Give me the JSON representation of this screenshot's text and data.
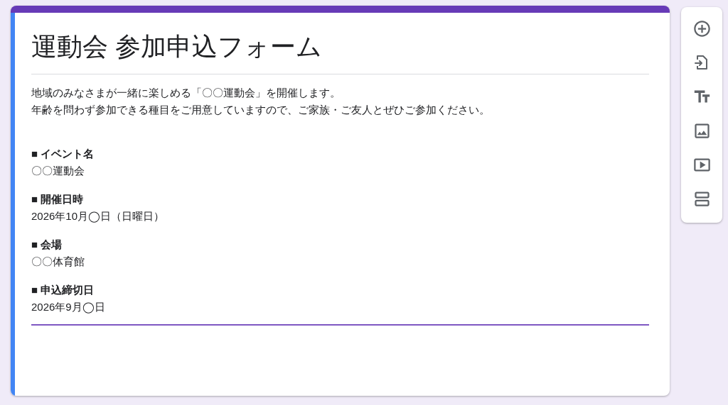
{
  "form": {
    "title": "運動会 参加申込フォーム",
    "description": [
      "地域のみなさまが一緒に楽しめる「〇〇運動会」を開催します。",
      "年齢を問わず参加できる種目をご用意していますので、ご家族・ご友人とぜひご参加ください。"
    ],
    "sections": [
      {
        "label": "■ イベント名",
        "value": "〇〇運動会"
      },
      {
        "label": "■ 開催日時",
        "value": "2026年10月◯日（日曜日）"
      },
      {
        "label": "■ 会場",
        "value": "〇〇体育館"
      },
      {
        "label": "■ 申込締切日",
        "value": "2026年9月◯日"
      }
    ]
  }
}
